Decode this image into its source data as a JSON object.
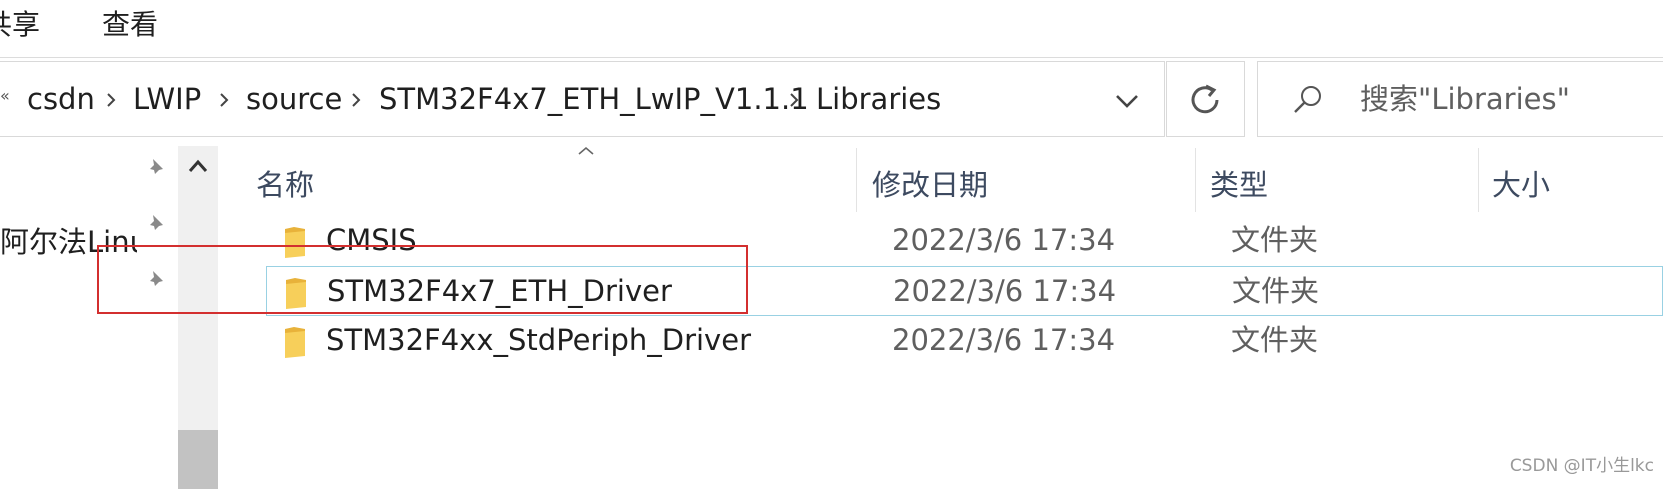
{
  "ribbon": {
    "share_label": "共享",
    "view_label": "查看"
  },
  "address": {
    "overflow_label": "«",
    "crumbs": [
      "csdn",
      "LWIP",
      "source",
      "STM32F4x7_ETH_LwIP_V1.1.1",
      "Libraries"
    ]
  },
  "search": {
    "placeholder": "搜索\"Libraries\""
  },
  "nav": {
    "partial_label": "阿尔法Linu:"
  },
  "columns": {
    "name": "名称",
    "modified": "修改日期",
    "type": "类型",
    "size": "大小"
  },
  "files": [
    {
      "name": "CMSIS",
      "modified": "2022/3/6 17:34",
      "type": "文件夹"
    },
    {
      "name": "STM32F4x7_ETH_Driver",
      "modified": "2022/3/6 17:34",
      "type": "文件夹"
    },
    {
      "name": "STM32F4xx_StdPeriph_Driver",
      "modified": "2022/3/6 17:34",
      "type": "文件夹"
    }
  ],
  "selected_row": "STM32F4x7_ETH_Driver",
  "watermark": "CSDN @IT小生lkc",
  "colors": {
    "highlight": "#d32f2f",
    "selection_border": "#99d1e3",
    "folder": "#f7c948"
  }
}
